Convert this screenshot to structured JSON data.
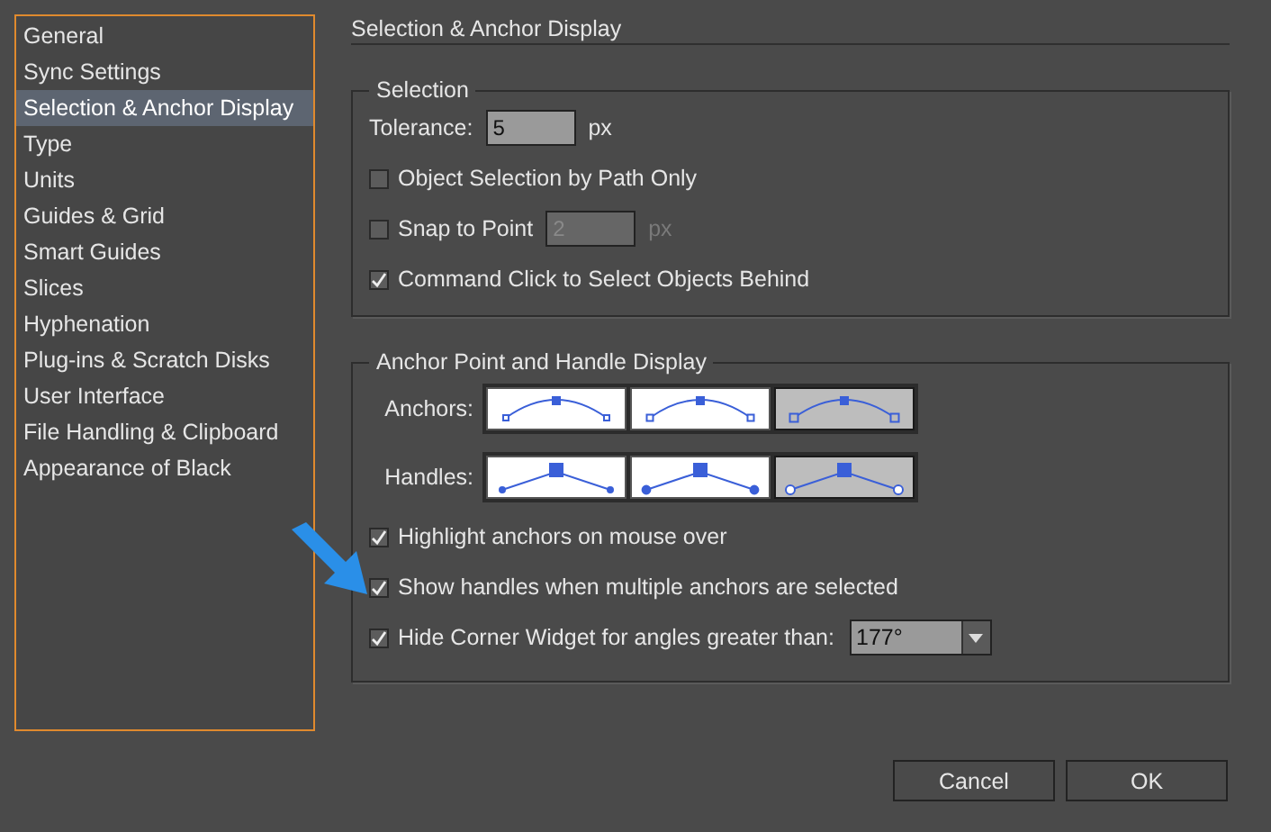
{
  "sidebar": {
    "items": [
      {
        "label": "General",
        "selected": false
      },
      {
        "label": "Sync Settings",
        "selected": false
      },
      {
        "label": "Selection & Anchor Display",
        "selected": true
      },
      {
        "label": "Type",
        "selected": false
      },
      {
        "label": "Units",
        "selected": false
      },
      {
        "label": "Guides & Grid",
        "selected": false
      },
      {
        "label": "Smart Guides",
        "selected": false
      },
      {
        "label": "Slices",
        "selected": false
      },
      {
        "label": "Hyphenation",
        "selected": false
      },
      {
        "label": "Plug-ins & Scratch Disks",
        "selected": false
      },
      {
        "label": "User Interface",
        "selected": false
      },
      {
        "label": "File Handling & Clipboard",
        "selected": false
      },
      {
        "label": "Appearance of Black",
        "selected": false
      }
    ]
  },
  "page_title": "Selection & Anchor Display",
  "selection_group": {
    "title": "Selection",
    "tolerance": {
      "label": "Tolerance:",
      "value": "5",
      "unit": "px"
    },
    "options": [
      {
        "kind": "checkbox",
        "label": "Object Selection by Path Only",
        "checked": false
      },
      {
        "kind": "checkbox_field",
        "label": "Snap to Point",
        "checked": false,
        "value": "2",
        "unit": "px",
        "disabled": true
      },
      {
        "kind": "checkbox",
        "label": "Command Click to Select Objects Behind",
        "checked": true
      }
    ]
  },
  "anchor_group": {
    "title": "Anchor Point and Handle Display",
    "anchors": {
      "label": "Anchors:",
      "options": [
        {
          "selected": false
        },
        {
          "selected": false
        },
        {
          "selected": true
        }
      ]
    },
    "handles": {
      "label": "Handles:",
      "options": [
        {
          "selected": false
        },
        {
          "selected": false
        },
        {
          "selected": true
        }
      ]
    },
    "options": [
      {
        "kind": "checkbox",
        "label": "Highlight anchors on mouse over",
        "checked": true
      },
      {
        "kind": "checkbox",
        "label": "Show handles when multiple anchors are selected",
        "checked": true
      },
      {
        "kind": "checkbox_select",
        "label": "Hide Corner Widget for angles greater than:",
        "checked": true,
        "value": "177°"
      }
    ]
  },
  "buttons": [
    {
      "label": "Cancel"
    },
    {
      "label": "OK"
    }
  ]
}
